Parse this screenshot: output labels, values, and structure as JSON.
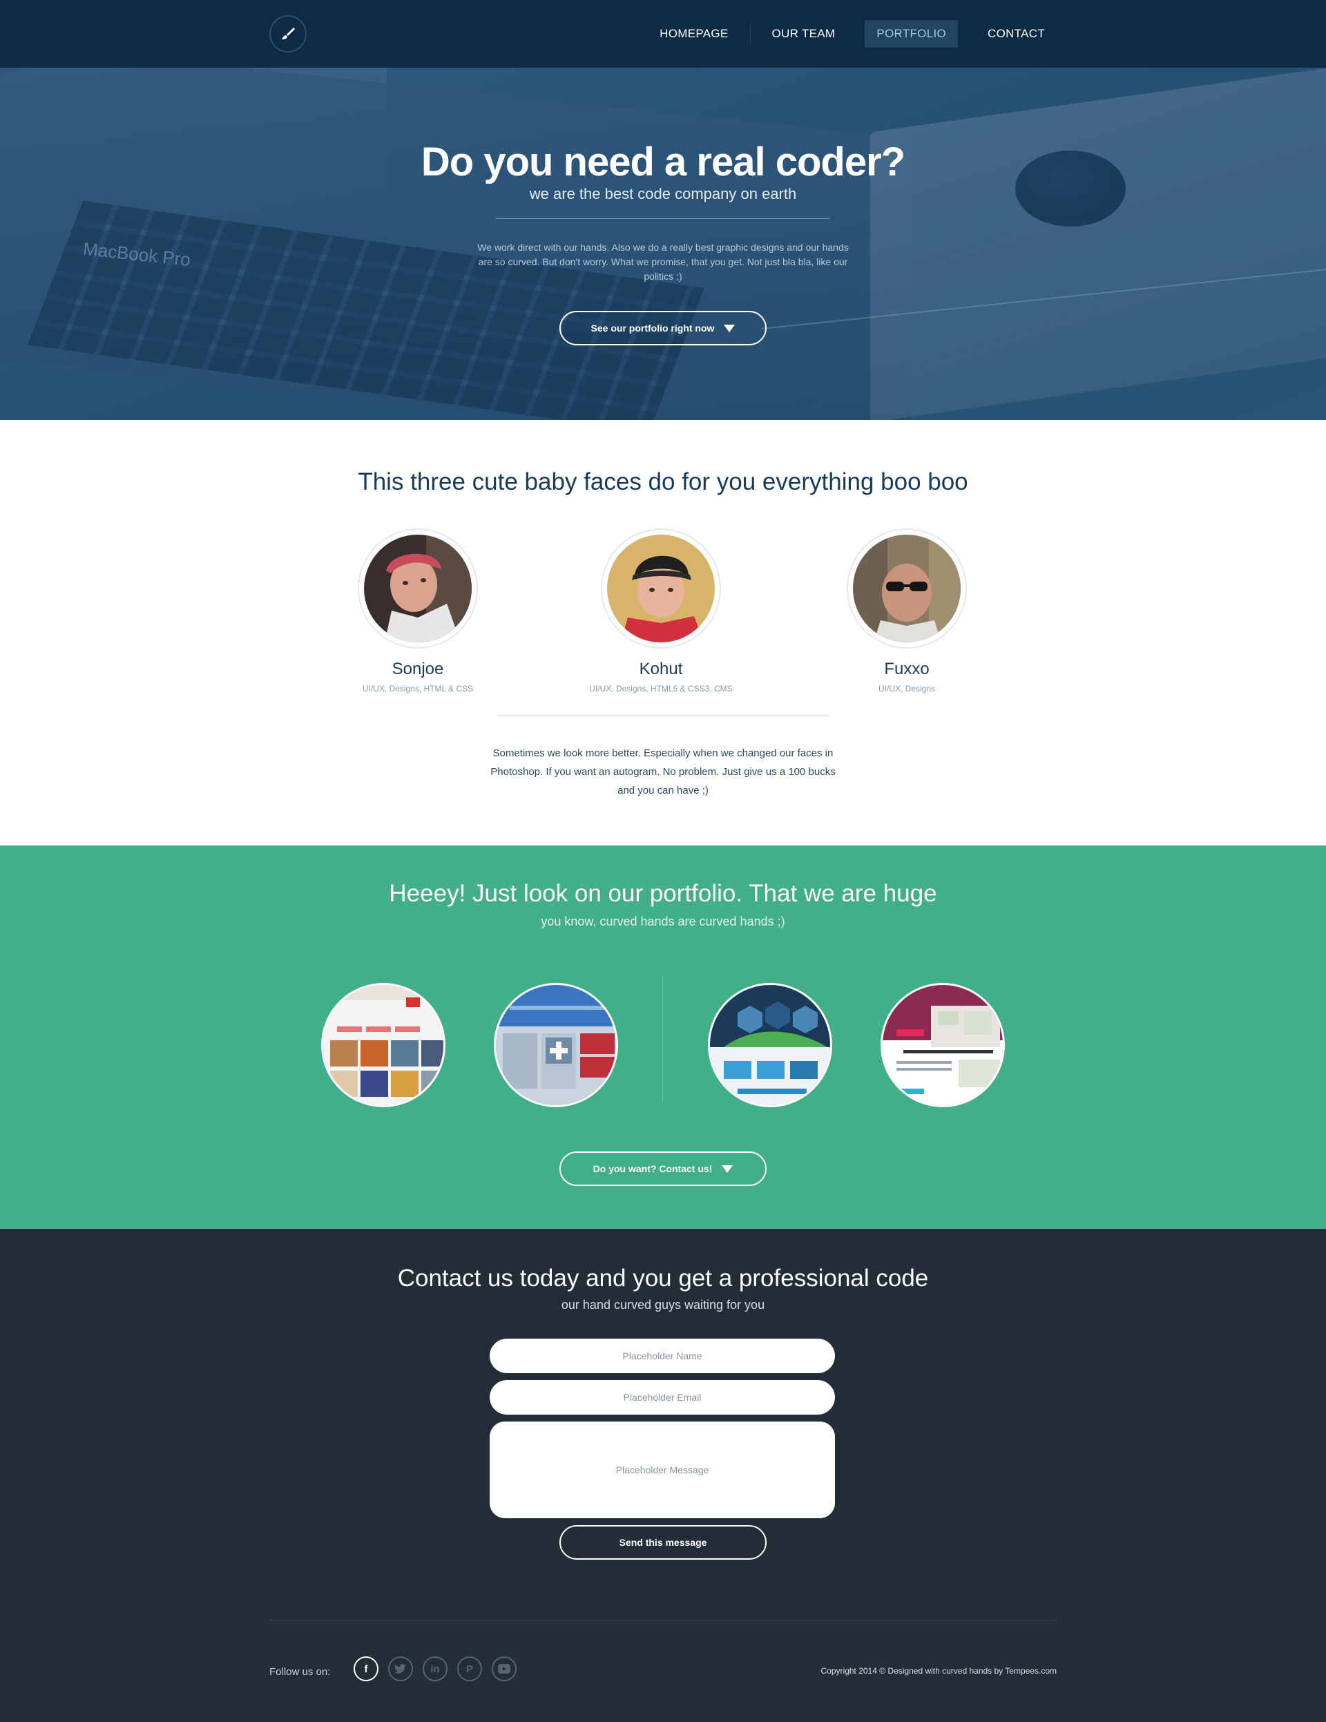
{
  "nav": {
    "items": [
      {
        "label": "HOMEPAGE"
      },
      {
        "label": "OUR TEAM"
      },
      {
        "label": "PORTFOLIO",
        "active": true
      },
      {
        "label": "CONTACT"
      }
    ]
  },
  "hero": {
    "title": "Do you need a real coder?",
    "subtitle": "we are the best code company on earth",
    "description": "We work direct with our hands. Also we do a really best graphic designs and our hands are so curved. But don't worry. What we promise, that you get. Not just bla bla, like our politics ;)",
    "button_label": "See our portfolio right now",
    "background_text": "MacBook Pro"
  },
  "team": {
    "title": "This three cute baby faces do for you everything boo boo",
    "members": [
      {
        "name": "Sonjoe",
        "role": "UI/UX, Designs, HTML & CSS"
      },
      {
        "name": "Kohut",
        "role": "UI/UX, Designs, HTML5 & CSS3, CMS"
      },
      {
        "name": "Fuxxo",
        "role": "UI/UX, Designs"
      }
    ],
    "note": "Sometimes we look more better. Especially when we changed our faces in Photoshop. If you want an autogram. No problem. Just give us a 100 bucks and you can have ;)"
  },
  "portfolio": {
    "title": "Heeey! Just look on our portfolio. That we are huge",
    "subtitle": "you know, curved hands are curved hands ;)",
    "button_label": "Do you want? Contact us!"
  },
  "contact": {
    "title": "Contact us today and you get a professional code",
    "subtitle": "our hand curved guys waiting for you",
    "name_placeholder": "Placeholder Name",
    "email_placeholder": "Placeholder Email",
    "message_placeholder": "Placeholder Message",
    "send_label": "Send this message"
  },
  "footer": {
    "follow_label": "Follow us on:",
    "socials": [
      "facebook-icon",
      "twitter-icon",
      "linkedin-icon",
      "pinterest-icon",
      "youtube-icon"
    ],
    "copyright": "Copyright 2014 © Designed with curved hands by Tempees.com"
  },
  "colors": {
    "nav_bg": "#0e2b45",
    "hero_overlay": "#2c5477",
    "portfolio_bg": "#41af89",
    "contact_bg": "#222d37",
    "heading_blue": "#173c5b"
  }
}
